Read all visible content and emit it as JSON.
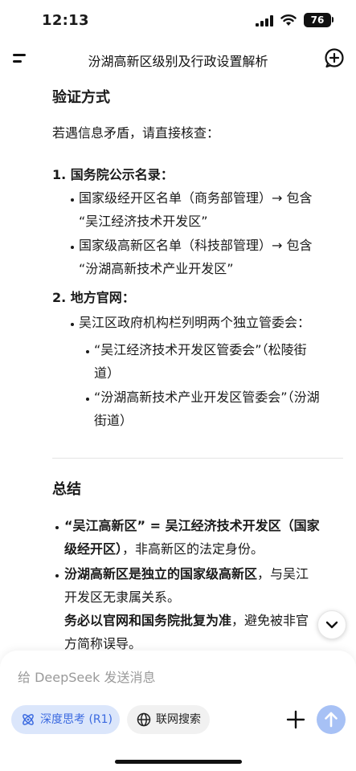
{
  "status": {
    "time": "12:13",
    "battery": "76"
  },
  "header": {
    "title": "汾湖高新区级别及行政设置解析"
  },
  "section_verify": {
    "heading": "验证方式",
    "intro": "若遇信息矛盾，请直接核查：",
    "items": [
      {
        "num": "1.",
        "title": "国务院公示名录",
        "colon": "：",
        "subs": [
          {
            "line1": "国家级经开区名单（商务部管理）→ 包含",
            "line2": "“吴江经济技术开发区”"
          },
          {
            "line1": "国家级高新区名单（科技部管理）→ 包含",
            "line2": "“汾湖高新技术产业开发区”"
          }
        ]
      },
      {
        "num": "2.",
        "title": "地方官网",
        "colon": "：",
        "subs": [
          {
            "line1": "吴江区政府机构栏列明两个独立管委会："
          }
        ],
        "subsubs": [
          {
            "line1": "“吴江经济技术开发区管委会”（松陵街",
            "line2": "道）"
          },
          {
            "line1": "“汾湖高新技术产业开发区管委会”（汾湖",
            "line2": "街道）"
          }
        ]
      }
    ]
  },
  "section_summary": {
    "heading": "总结",
    "b1": {
      "bold_a": "“吴江高新区” = 吴江经济技术开发区（国家",
      "bold_b": "级经开区）",
      "rest": "，非高新区的法定身份。"
    },
    "b2": {
      "bold_a": "汾湖高新区是独立的国家级高新区",
      "rest_a": "，与吴江",
      "rest_b": "开发区无隶属关系。",
      "bold_c": "务必以官网和国务院批复为准",
      "rest_c": "，避免被非官",
      "rest_d": "方简称误导。"
    }
  },
  "composer": {
    "placeholder": "给 DeepSeek 发送消息",
    "deep_think": "深度思考 (R1)",
    "web_search": "联网搜索"
  },
  "icons": {
    "menu": "menu-icon",
    "new_chat": "new-chat-icon",
    "scroll_down": "chevron-down-icon",
    "deep_think": "atom-icon",
    "web_search": "globe-icon",
    "plus": "plus-icon",
    "send": "arrow-up-icon"
  },
  "colors": {
    "accent": "#3b6ae0",
    "chip_bg": "#dbe6fb",
    "send_bg": "#a7c1f5"
  }
}
